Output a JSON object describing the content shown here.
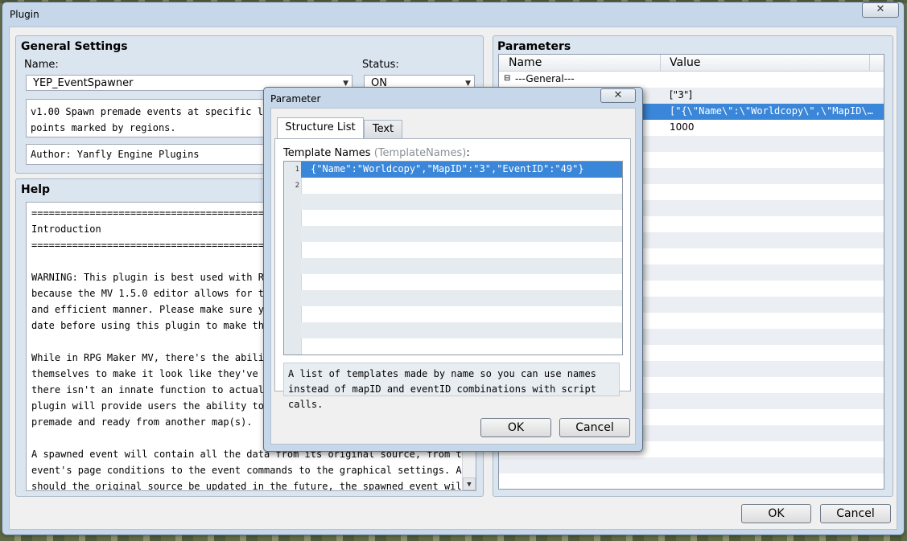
{
  "window": {
    "title": "Plugin",
    "close_glyph": "✕"
  },
  "general": {
    "title": "General Settings",
    "name_label": "Name:",
    "name_value": "YEP_EventSpawner",
    "status_label": "Status:",
    "status_value": "ON",
    "description_lines": [
      "v1.00 Spawn premade events at specific locat",
      "points marked by regions."
    ],
    "author": "Author: Yanfly Engine Plugins"
  },
  "help": {
    "title": "Help",
    "lines": [
      "=================================================",
      "Introduction",
      "=================================================",
      "",
      "WARNING: This plugin is best used with RPG (",
      "because the MV 1.5.0 editor allows for this",
      "and efficient manner. Please make sure your",
      "date before using this plugin to make the m",
      "",
      "While in RPG Maker MV, there's the ability",
      "themselves to make it look like they've spa",
      "there isn't an innate function to actually",
      "plugin will provide users the ability to ac",
      "premade and ready from another map(s).",
      "",
      "A spawned event will contain all the data from its original source, from the",
      "event's page conditions to the event commands to the graphical settings. And",
      "should the original source be updated in the future, the spawned event will"
    ]
  },
  "parameters": {
    "title": "Parameters",
    "col_name": "Name",
    "col_value": "Value",
    "rows": [
      {
        "name": "---General---",
        "value": ""
      },
      {
        "name": "",
        "value": "[\"3\"]"
      },
      {
        "name": "",
        "value": "[\"{\\\"Name\\\":\\\"Worldcopy\\\",\\\"MapID\\…"
      },
      {
        "name": "",
        "value": "1000"
      }
    ]
  },
  "dialog": {
    "title": "Parameter",
    "close_glyph": "✕",
    "tabs": [
      "Structure List",
      "Text"
    ],
    "field_label": "Template Names",
    "field_key": "(TemplateNames)",
    "field_colon": ":",
    "editor_lines": [
      {
        "num": "1",
        "text": "{\"Name\":\"Worldcopy\",\"MapID\":\"3\",\"EventID\":\"49\"}"
      },
      {
        "num": "2",
        "text": ""
      }
    ],
    "description_lines": [
      "A list of templates made by name so you can use names",
      "instead of mapID and eventID combinations with script calls."
    ],
    "ok_label": "OK",
    "cancel_label": "Cancel"
  },
  "footer": {
    "ok_label": "OK",
    "cancel_label": "Cancel"
  },
  "colors": {
    "selection": "#3a86d8",
    "window_frame": "#c6d7e9"
  }
}
